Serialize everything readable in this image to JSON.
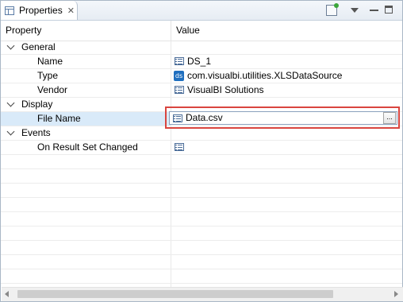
{
  "view": {
    "title": "Properties",
    "close_glyph": "✕"
  },
  "toolbar": {
    "icons": [
      "pin-editor-icon",
      "view-menu-icon",
      "minimize-icon",
      "maximize-icon"
    ]
  },
  "table": {
    "headers": {
      "property": "Property",
      "value": "Value"
    },
    "groups": {
      "general": {
        "label": "General",
        "name": {
          "label": "Name",
          "value": "DS_1"
        },
        "type": {
          "label": "Type",
          "value": "com.visualbi.utilities.XLSDataSource",
          "icon_text": "ds"
        },
        "vendor": {
          "label": "Vendor",
          "value": "VisualBI Solutions"
        }
      },
      "display": {
        "label": "Display",
        "file_name": {
          "label": "File Name",
          "value": "Data.csv",
          "button_label": "..."
        }
      },
      "events": {
        "label": "Events",
        "on_result_set_changed": {
          "label": "On Result Set Changed",
          "value": ""
        }
      }
    }
  },
  "colors": {
    "selected_row": "#d9eaf9",
    "highlight_border": "#d9453f",
    "icon_blue": "#4b6d99"
  }
}
